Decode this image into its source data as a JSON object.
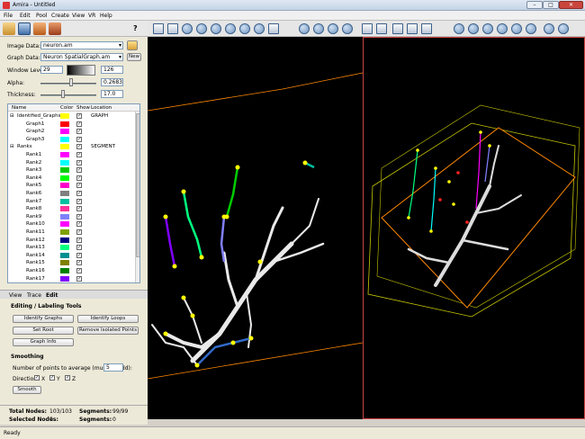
{
  "window": {
    "title": "Amira - Untitled",
    "minimize": "–",
    "maximize": "□",
    "close": "✕"
  },
  "menu": [
    "File",
    "Edit",
    "Pool",
    "Create",
    "View",
    "VR",
    "Help"
  ],
  "toolbar_left_help": "?",
  "form": {
    "image_data_label": "Image Data:",
    "image_data_value": "neuron.am",
    "graph_data_label": "Graph Data:",
    "graph_data_value": "Neuron SpatialGraph.am",
    "new_button": "New",
    "window_level_label": "Window Level:",
    "window_level_low": "29",
    "window_level_high": "126",
    "alpha_label": "Alpha:",
    "alpha_value": "0.2683",
    "alpha_fraction": 0.55,
    "thickness_label": "Thickness:",
    "thickness_value": "17.0",
    "thickness_fraction": 0.4
  },
  "tree": {
    "headers": {
      "name": "Name",
      "color": "Color",
      "show": "Show",
      "location": "Location"
    },
    "groups": [
      {
        "label": "Identified_Graphs",
        "color": "#ffff00",
        "location": "GRAPH",
        "items": [
          {
            "label": "Graph1",
            "color": "#ff0000"
          },
          {
            "label": "Graph2",
            "color": "#ff00ff"
          },
          {
            "label": "Graph3",
            "color": "#00ffff"
          }
        ]
      },
      {
        "label": "Ranks",
        "color": "#ffff00",
        "location": "SEGMENT",
        "items": [
          {
            "label": "Rank1",
            "color": "#ff00ff"
          },
          {
            "label": "Rank2",
            "color": "#00ffff"
          },
          {
            "label": "Rank3",
            "color": "#00cc00"
          },
          {
            "label": "Rank4",
            "color": "#00ff00"
          },
          {
            "label": "Rank5",
            "color": "#ff00cc"
          },
          {
            "label": "Rank6",
            "color": "#808080"
          },
          {
            "label": "Rank7",
            "color": "#00c0a0"
          },
          {
            "label": "Rank8",
            "color": "#ff3399"
          },
          {
            "label": "Rank9",
            "color": "#8080ff"
          },
          {
            "label": "Rank10",
            "color": "#ff00ff"
          },
          {
            "label": "Rank11",
            "color": "#80a000"
          },
          {
            "label": "Rank12",
            "color": "#000080"
          },
          {
            "label": "Rank13",
            "color": "#00ff80"
          },
          {
            "label": "Rank14",
            "color": "#009090"
          },
          {
            "label": "Rank15",
            "color": "#808000"
          },
          {
            "label": "Rank16",
            "color": "#008000"
          },
          {
            "label": "Rank17",
            "color": "#8000ff"
          }
        ]
      }
    ]
  },
  "tabs": [
    "View",
    "Trace",
    "Edit"
  ],
  "editing": {
    "heading": "Editing / Labeling Tools",
    "identify_graphs": "Identify Graphs",
    "identify_loops": "Identify Loops",
    "set_root": "Set Root",
    "remove_isolated": "Remove Isolated Points",
    "graph_info": "Graph Info"
  },
  "smoothing": {
    "heading": "Smoothing",
    "points_label": "Number of points to average (must be odd):",
    "points_value": "5",
    "direction_label": "Direction:",
    "x": "X",
    "y": "Y",
    "z": "Z",
    "smooth_button": "Smooth"
  },
  "stats": {
    "total_nodes_label": "Total Nodes:",
    "total_nodes_value": "103/103",
    "segments_label": "Segments:",
    "segments_value": "99/99",
    "selected_nodes_label": "Selected Nodes:",
    "selected_nodes_value": "0",
    "selected_segments_label": "Segments:",
    "selected_segments_value": "0"
  },
  "status": "Ready",
  "colors": {
    "accent": "#316ac5",
    "node": "#ffff00",
    "box": "#ff8800"
  }
}
